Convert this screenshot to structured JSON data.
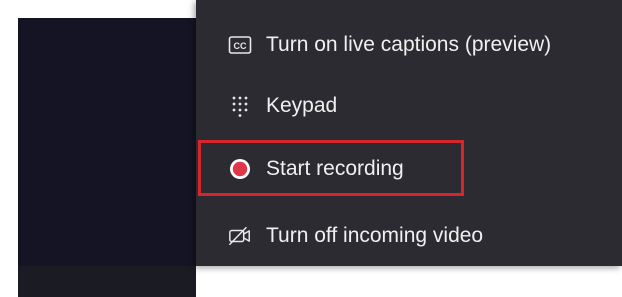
{
  "menu": {
    "items": [
      {
        "label": "Turn on live captions (preview)",
        "icon": "closed-captions-icon"
      },
      {
        "label": "Keypad",
        "icon": "dialpad-icon"
      },
      {
        "label": "Start recording",
        "icon": "record-icon",
        "highlighted": true
      },
      {
        "label": "Turn off incoming video",
        "icon": "video-off-icon"
      }
    ]
  },
  "colors": {
    "menu_bg": "#2b2b31",
    "text": "#f0f0f0",
    "record_red": "#e0364a",
    "highlight_border": "#d7262b",
    "backdrop": "#151424"
  }
}
